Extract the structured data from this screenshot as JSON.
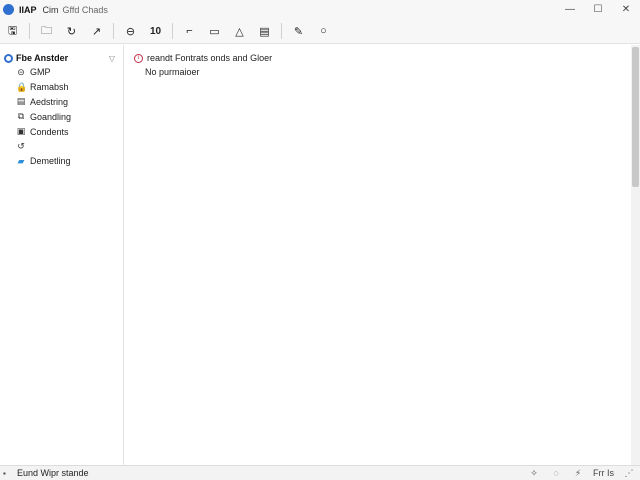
{
  "titlebar": {
    "app_name": "IIAP",
    "subtitle": "Cim",
    "document": "Gffd Chads",
    "minimize": "—",
    "maximize": "☐",
    "close": "✕"
  },
  "toolbar": {
    "buttons": [
      {
        "icon": "save-icon",
        "glyph": "🖫"
      },
      {
        "icon": "open-folder-icon",
        "glyph": "🗀"
      },
      {
        "icon": "refresh-icon",
        "glyph": "↻"
      },
      {
        "icon": "arrow-icon",
        "glyph": "↗"
      },
      {
        "icon": "minus-circle-icon",
        "glyph": "⊖"
      },
      {
        "icon": "number-icon",
        "glyph": "10"
      },
      {
        "icon": "corner-icon",
        "glyph": "⌐"
      },
      {
        "icon": "image-icon",
        "glyph": "▭"
      },
      {
        "icon": "triangle-icon",
        "glyph": "△"
      },
      {
        "icon": "note-icon",
        "glyph": "▤"
      },
      {
        "icon": "pencil-icon",
        "glyph": "✎"
      },
      {
        "icon": "circle-icon",
        "glyph": "○"
      }
    ]
  },
  "sidebar": {
    "root_label": "Fbe Anstder",
    "collapse_glyph": "▽",
    "items": [
      {
        "label": "GMP",
        "icon": "link-icon",
        "glyph": "⊝"
      },
      {
        "label": "Ramabsh",
        "icon": "lock-icon",
        "glyph": "🔒"
      },
      {
        "label": "Aedstring",
        "icon": "document-icon",
        "glyph": "▤"
      },
      {
        "label": "Goandling",
        "icon": "puzzle-icon",
        "glyph": "⧉"
      },
      {
        "label": "Condents",
        "icon": "grid-icon",
        "glyph": "▣"
      },
      {
        "label": "",
        "icon": "undo-icon",
        "glyph": "↺"
      },
      {
        "label": "Demetling",
        "icon": "folder-icon",
        "glyph": "▰"
      }
    ]
  },
  "content": {
    "message_title": "reandt Fontrats onds and Gloer",
    "message_sub": "No purmaioer"
  },
  "statusbar": {
    "text": "Eund Wipr stande",
    "pos": "Frr Is",
    "icons": [
      "✧",
      "◌",
      "⚡"
    ]
  }
}
